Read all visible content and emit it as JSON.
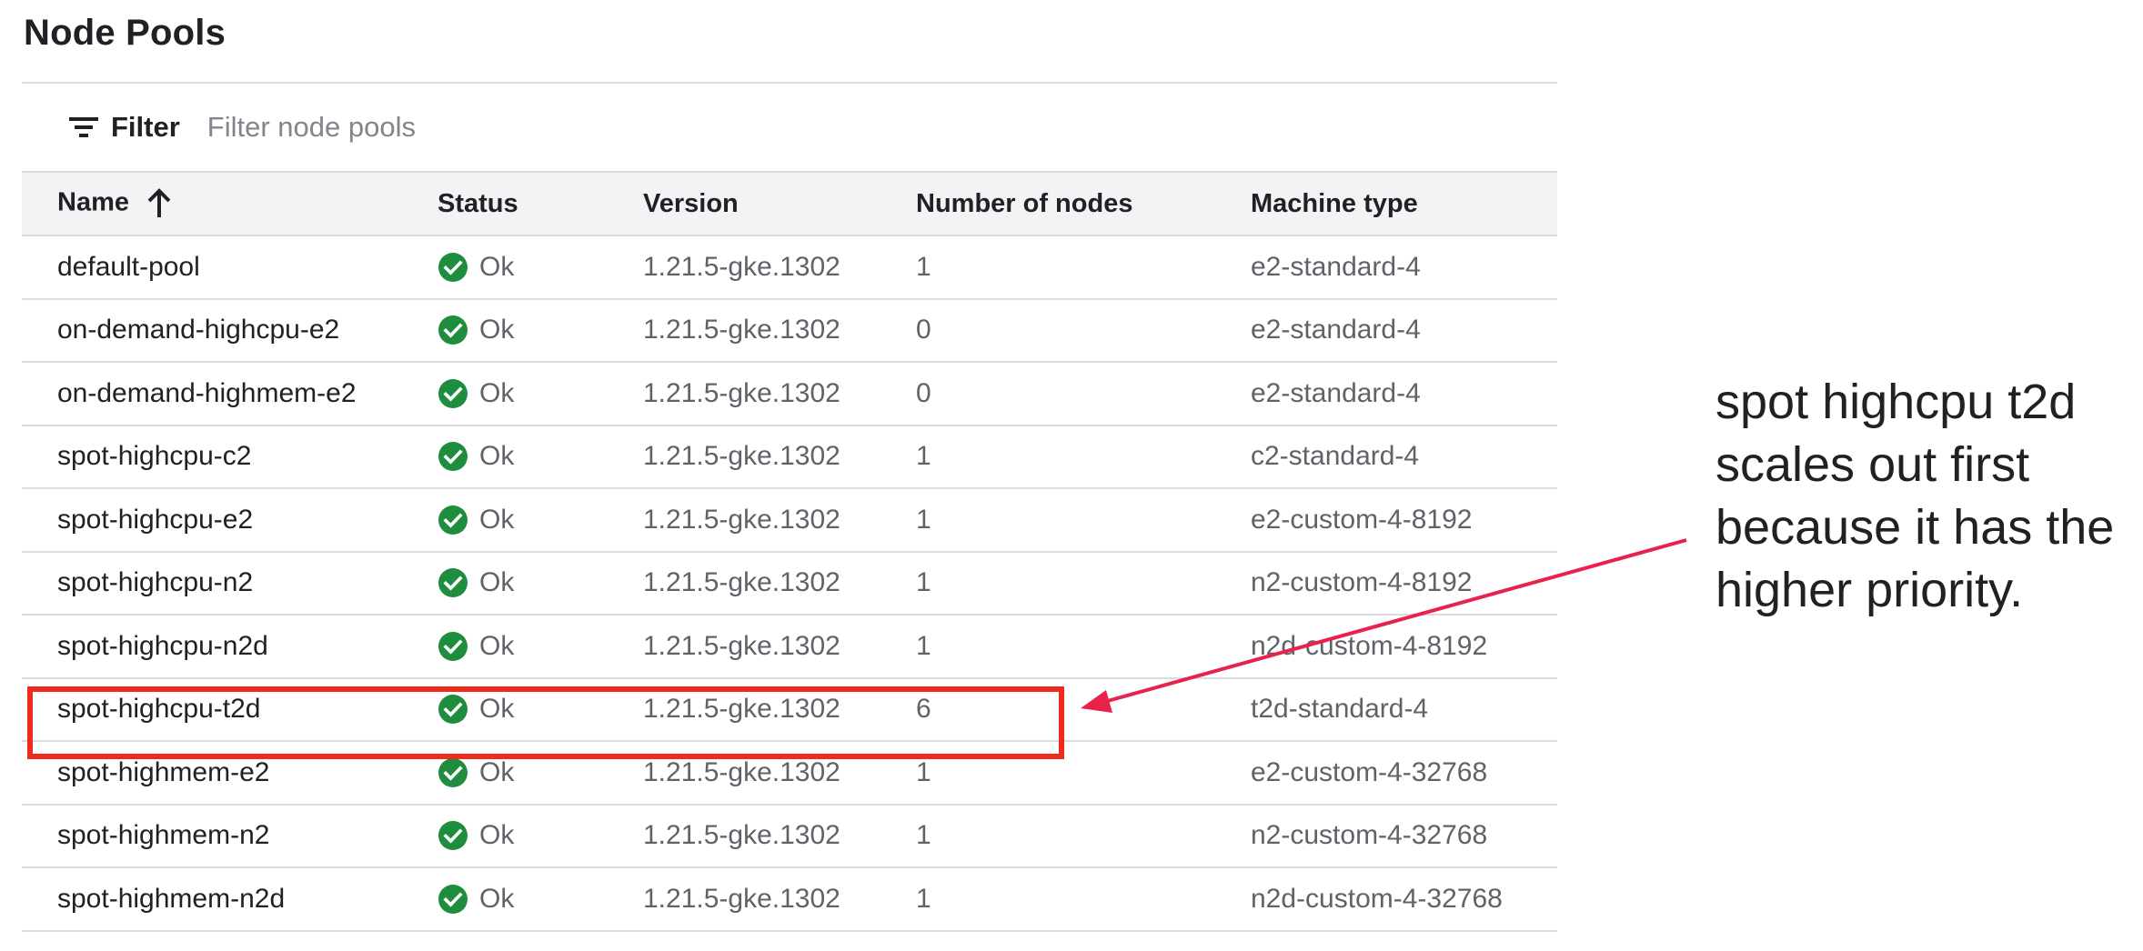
{
  "page_title": "Node Pools",
  "filter": {
    "label": "Filter",
    "icon": "filter-list-icon",
    "placeholder": "Filter node pools",
    "value": ""
  },
  "table": {
    "columns": [
      "Name",
      "Status",
      "Version",
      "Number of nodes",
      "Machine type"
    ],
    "sort": {
      "column": "Name",
      "direction": "ascending",
      "icon": "arrow-upward-icon"
    },
    "rows": [
      {
        "name": "default-pool",
        "status": "Ok",
        "version": "1.21.5-gke.1302",
        "nodes": "1",
        "machine_type": "e2-standard-4"
      },
      {
        "name": "on-demand-highcpu-e2",
        "status": "Ok",
        "version": "1.21.5-gke.1302",
        "nodes": "0",
        "machine_type": "e2-standard-4"
      },
      {
        "name": "on-demand-highmem-e2",
        "status": "Ok",
        "version": "1.21.5-gke.1302",
        "nodes": "0",
        "machine_type": "e2-standard-4"
      },
      {
        "name": "spot-highcpu-c2",
        "status": "Ok",
        "version": "1.21.5-gke.1302",
        "nodes": "1",
        "machine_type": "c2-standard-4"
      },
      {
        "name": "spot-highcpu-e2",
        "status": "Ok",
        "version": "1.21.5-gke.1302",
        "nodes": "1",
        "machine_type": "e2-custom-4-8192"
      },
      {
        "name": "spot-highcpu-n2",
        "status": "Ok",
        "version": "1.21.5-gke.1302",
        "nodes": "1",
        "machine_type": "n2-custom-4-8192"
      },
      {
        "name": "spot-highcpu-n2d",
        "status": "Ok",
        "version": "1.21.5-gke.1302",
        "nodes": "1",
        "machine_type": "n2d-custom-4-8192"
      },
      {
        "name": "spot-highcpu-t2d",
        "status": "Ok",
        "version": "1.21.5-gke.1302",
        "nodes": "6",
        "machine_type": "t2d-standard-4"
      },
      {
        "name": "spot-highmem-e2",
        "status": "Ok",
        "version": "1.21.5-gke.1302",
        "nodes": "1",
        "machine_type": "e2-custom-4-32768"
      },
      {
        "name": "spot-highmem-n2",
        "status": "Ok",
        "version": "1.21.5-gke.1302",
        "nodes": "1",
        "machine_type": "n2-custom-4-32768"
      },
      {
        "name": "spot-highmem-n2d",
        "status": "Ok",
        "version": "1.21.5-gke.1302",
        "nodes": "1",
        "machine_type": "n2d-custom-4-32768"
      }
    ],
    "status_icon": "check-circle-icon"
  },
  "annotation": {
    "lines": [
      "spot highcpu t2d",
      "scales out first",
      "because it has the",
      "higher priority."
    ],
    "highlighted_row": "spot-highcpu-t2d",
    "color": "#ef2b1c",
    "arrow_color": "#e8224a"
  },
  "colors": {
    "ok_green": "#1e8e3e",
    "header_bg": "#f1f3f4",
    "divider": "#dadce0"
  }
}
